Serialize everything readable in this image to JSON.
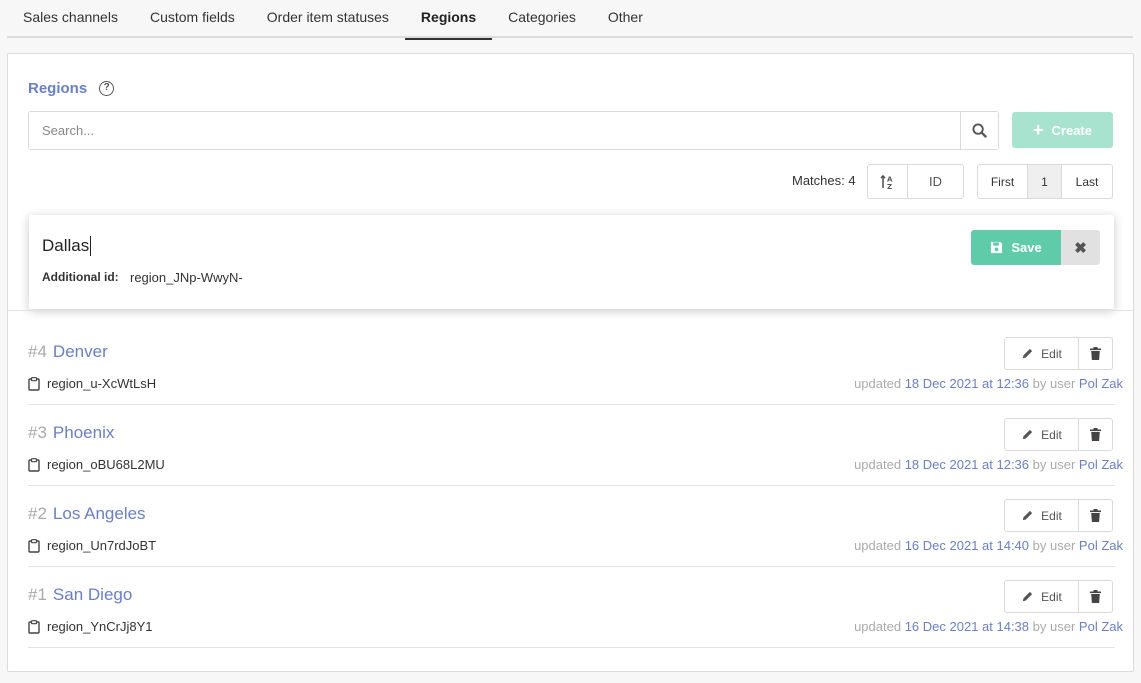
{
  "tabs": [
    {
      "label": "Sales channels"
    },
    {
      "label": "Custom fields"
    },
    {
      "label": "Order item statuses"
    },
    {
      "label": "Regions"
    },
    {
      "label": "Categories"
    },
    {
      "label": "Other"
    }
  ],
  "active_tab": "Regions",
  "section": {
    "title": "Regions"
  },
  "search": {
    "placeholder": "Search...",
    "value": ""
  },
  "create_label": "Create",
  "matches_text": "Matches: 4",
  "sort": {
    "field": "ID"
  },
  "pager": {
    "first": "First",
    "current": "1",
    "last": "Last"
  },
  "editor": {
    "name": "Dallas",
    "additional_label": "Additional id:",
    "additional_value": "region_JNp-WwyN-",
    "save_label": "Save"
  },
  "regions": [
    {
      "num": "#4",
      "name": "Denver",
      "id": "region_u-XcWtLsH",
      "updated_prefix": "updated",
      "date": "18 Dec 2021 at 12:36",
      "by_text": "by user",
      "user": "Pol Zak"
    },
    {
      "num": "#3",
      "name": "Phoenix",
      "id": "region_oBU68L2MU",
      "updated_prefix": "updated",
      "date": "18 Dec 2021 at 12:36",
      "by_text": "by user",
      "user": "Pol Zak"
    },
    {
      "num": "#2",
      "name": "Los Angeles",
      "id": "region_Un7rdJoBT",
      "updated_prefix": "updated",
      "date": "16 Dec 2021 at 14:40",
      "by_text": "by user",
      "user": "Pol Zak"
    },
    {
      "num": "#1",
      "name": "San Diego",
      "id": "region_YnCrJj8Y1",
      "updated_prefix": "updated",
      "date": "16 Dec 2021 at 14:38",
      "by_text": "by user",
      "user": "Pol Zak"
    }
  ],
  "edit_label": "Edit",
  "colors": {
    "accent": "#6a7fc4",
    "success": "#5fcba9",
    "success_disabled": "#a8e3cf"
  },
  "icons": {
    "help": "question-circle-icon",
    "search": "search-icon",
    "create": "plus-icon",
    "sort": "sort-icon",
    "save": "floppy-disk-icon",
    "close": "close-icon",
    "copy": "clipboard-icon",
    "edit": "pencil-icon",
    "delete": "trash-icon"
  }
}
